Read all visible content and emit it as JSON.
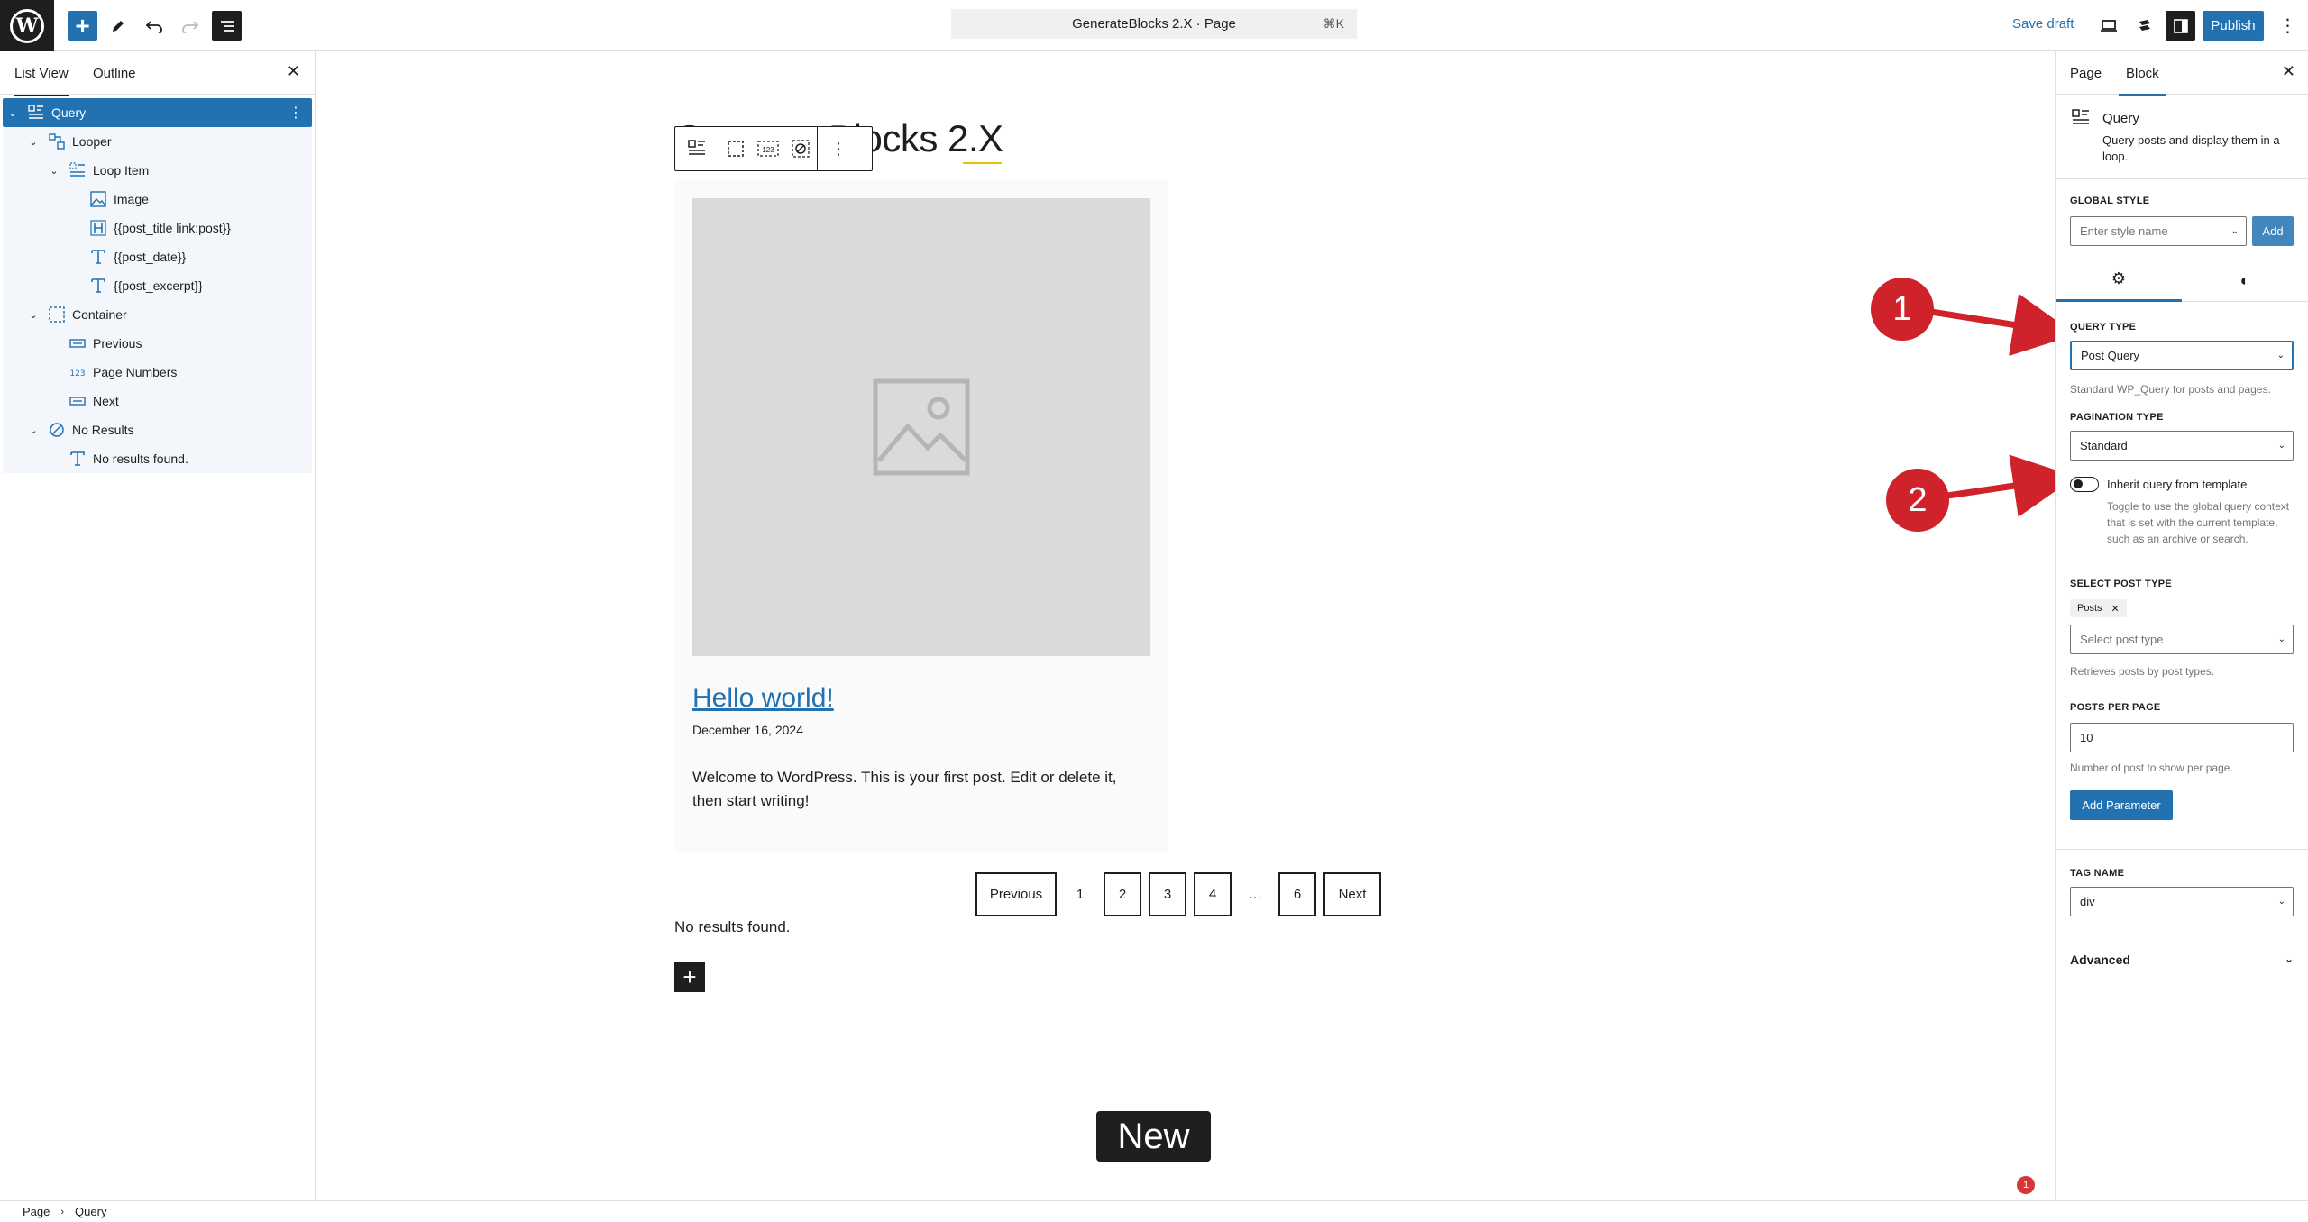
{
  "topbar": {
    "document_title": "GenerateBlocks 2.X · Page",
    "shortcut": "⌘K",
    "save_draft": "Save draft",
    "publish": "Publish"
  },
  "listview": {
    "tabs": [
      "List View",
      "Outline"
    ],
    "items": [
      {
        "label": "Query",
        "icon": "query-icon",
        "depth": 0,
        "expanded": true,
        "selected": true
      },
      {
        "label": "Looper",
        "icon": "looper-icon",
        "depth": 1,
        "expanded": true
      },
      {
        "label": "Loop Item",
        "icon": "loop-item-icon",
        "depth": 2,
        "expanded": true
      },
      {
        "label": "Image",
        "icon": "image-icon",
        "depth": 3
      },
      {
        "label": "{{post_title link:post}}",
        "icon": "heading-icon",
        "depth": 3
      },
      {
        "label": "{{post_date}}",
        "icon": "text-icon",
        "depth": 3
      },
      {
        "label": "{{post_excerpt}}",
        "icon": "text-icon",
        "depth": 3
      },
      {
        "label": "Container",
        "icon": "container-icon",
        "depth": 1,
        "expanded": true
      },
      {
        "label": "Previous",
        "icon": "button-icon",
        "depth": 2
      },
      {
        "label": "Page Numbers",
        "icon": "numbers-icon",
        "depth": 2
      },
      {
        "label": "Next",
        "icon": "button-icon",
        "depth": 2
      },
      {
        "label": "No Results",
        "icon": "no-results-icon",
        "depth": 1,
        "expanded": true
      },
      {
        "label": "No results found.",
        "icon": "text-icon",
        "depth": 2
      }
    ]
  },
  "canvas": {
    "page_title": "GenerateBlocks 2.X",
    "post": {
      "title": "Hello world!",
      "date": "December 16, 2024",
      "excerpt": "Welcome to WordPress. This is your first post. Edit or delete it, then start writing!"
    },
    "pagination": {
      "previous": "Previous",
      "pages": [
        "1",
        "2",
        "3",
        "4",
        "…",
        "6"
      ],
      "next": "Next"
    },
    "no_results": "No results found.",
    "overlay_label": "New",
    "notification_count": "1",
    "callouts": [
      "1",
      "2"
    ]
  },
  "sidebar": {
    "tabs": [
      "Page",
      "Block"
    ],
    "block_name": "Query",
    "block_description": "Query posts and display them in a loop.",
    "global_style_label": "GLOBAL STYLE",
    "style_placeholder": "Enter style name",
    "style_add": "Add",
    "query_type_label": "QUERY TYPE",
    "query_type_value": "Post Query",
    "query_type_help": "Standard WP_Query for posts and pages.",
    "pagination_type_label": "PAGINATION TYPE",
    "pagination_type_value": "Standard",
    "inherit_label": "Inherit query from template",
    "inherit_help": "Toggle to use the global query context that is set with the current template, such as an archive or search.",
    "select_post_type_label": "SELECT POST TYPE",
    "post_type_chip": "Posts",
    "post_type_placeholder": "Select post type",
    "post_type_help": "Retrieves posts by post types.",
    "posts_per_page_label": "POSTS PER PAGE",
    "posts_per_page_value": "10",
    "posts_per_page_help": "Number of post to show per page.",
    "add_parameter": "Add Parameter",
    "tag_name_label": "TAG NAME",
    "tag_name_value": "div",
    "advanced": "Advanced"
  },
  "footer": {
    "breadcrumb": [
      "Page",
      "Query"
    ]
  },
  "colors": {
    "accent": "#2271b1",
    "callout": "#d0222a",
    "dark": "#1e1e1e"
  }
}
